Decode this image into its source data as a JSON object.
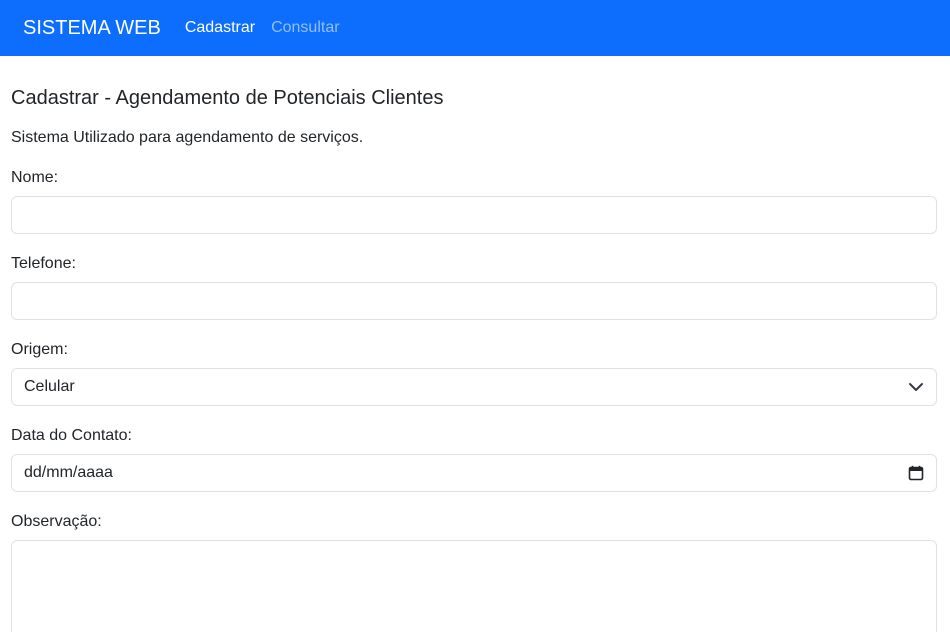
{
  "navbar": {
    "brand": "SISTEMA WEB",
    "links": [
      {
        "label": "Cadastrar",
        "active": true
      },
      {
        "label": "Consultar",
        "active": false
      }
    ],
    "color": "#0d6efd"
  },
  "page": {
    "title": "Cadastrar - Agendamento de Potenciais Clientes",
    "subtitle": "Sistema Utilizado para agendamento de serviços."
  },
  "form": {
    "nome": {
      "label": "Nome:",
      "value": ""
    },
    "telefone": {
      "label": "Telefone:",
      "value": ""
    },
    "origem": {
      "label": "Origem:",
      "selected": "Celular",
      "icon": "chevron-down-icon"
    },
    "data_contato": {
      "label": "Data do Contato:",
      "placeholder": "dd/mm/aaaa",
      "icon": "calendar-icon"
    },
    "observacao": {
      "label": "Observação:",
      "value": ""
    }
  }
}
